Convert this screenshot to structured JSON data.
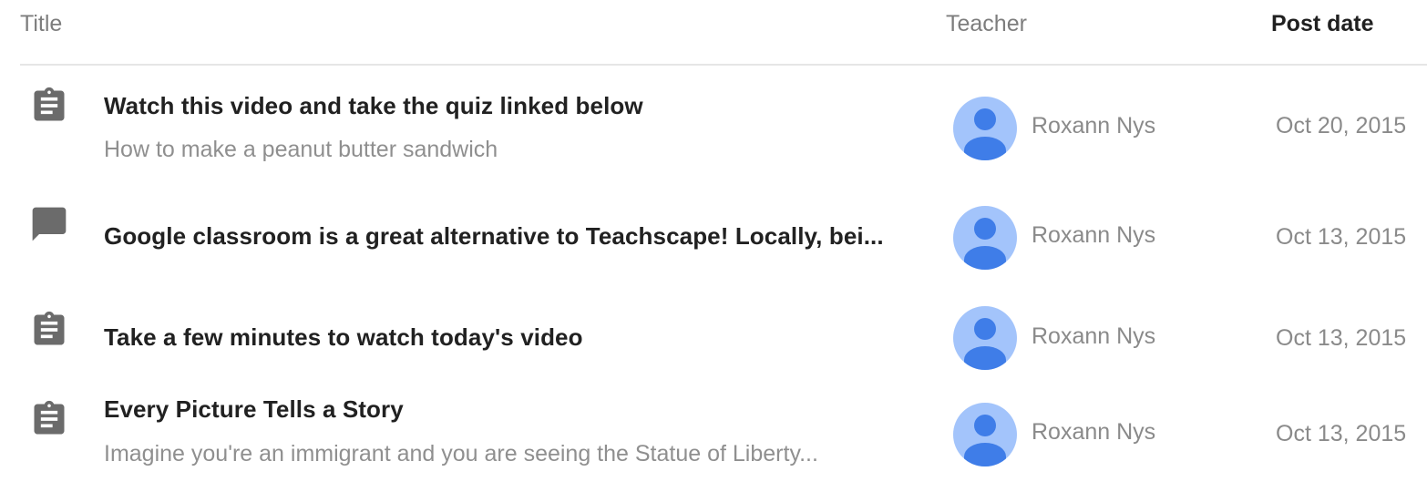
{
  "columns": {
    "title": "Title",
    "teacher": "Teacher",
    "post_date": "Post date"
  },
  "posts": [
    {
      "type_icon": "assignment-icon",
      "title": "Watch this video and take the quiz linked below",
      "subtitle": "How to make a peanut butter sandwich",
      "teacher": "Roxann Nys",
      "date": "Oct 20, 2015"
    },
    {
      "type_icon": "announcement-icon",
      "title": "Google classroom is a great alternative to Teachscape! Locally, bei...",
      "subtitle": "",
      "teacher": "Roxann Nys",
      "date": "Oct 13, 2015"
    },
    {
      "type_icon": "assignment-icon",
      "title": "Take a few minutes to watch today's video",
      "subtitle": "",
      "teacher": "Roxann Nys",
      "date": "Oct 13, 2015"
    },
    {
      "type_icon": "assignment-icon",
      "title": "Every Picture Tells a Story",
      "subtitle": "Imagine you're an immigrant and you are seeing the Statue of Liberty...",
      "teacher": "Roxann Nys",
      "date": "Oct 13, 2015"
    }
  ],
  "colors": {
    "icon_gray": "#6b6b6b",
    "avatar_bg": "#a3c4fb",
    "avatar_fg": "#3f7de8"
  }
}
